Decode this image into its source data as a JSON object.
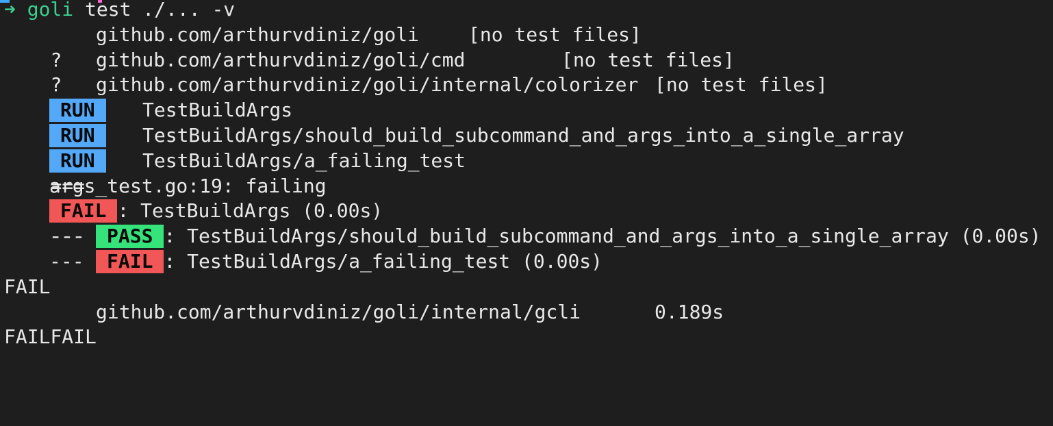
{
  "theme": {
    "background": "#1e1e1e",
    "foreground": "#e8e8e8",
    "prompt_color": "#3ccf91",
    "run_color": "#53a8f8",
    "fail_color": "#f25757",
    "pass_color": "#36e27a"
  },
  "prompt": {
    "arrow": "➜",
    "command_name": "goli",
    "args": " test ./... -v"
  },
  "no_test_lines": [
    {
      "marker": "?",
      "package": "github.com/arthurvdiniz/goli",
      "status": "[no test files]"
    },
    {
      "marker": "?",
      "package": "github.com/arthurvdiniz/goli/cmd",
      "status": "[no test files]"
    },
    {
      "marker": "?",
      "package": "github.com/arthurvdiniz/goli/internal/colorizer",
      "status": "[no test files]"
    }
  ],
  "run_lines": [
    {
      "prefix": "===",
      "badge": "RUN",
      "test": "TestBuildArgs"
    },
    {
      "prefix": "===",
      "badge": "RUN",
      "test": "TestBuildArgs/should_build_subcommand_and_args_into_a_single_array"
    },
    {
      "prefix": "===",
      "badge": "RUN",
      "test": "TestBuildArgs/a_failing_test"
    }
  ],
  "log_line": "args_test.go:19: failing",
  "result_lines": [
    {
      "prefix": "---",
      "badge": "FAIL",
      "text": ": TestBuildArgs (0.00s)",
      "indent": false
    },
    {
      "prefix": "---",
      "badge": "PASS",
      "text": ": TestBuildArgs/should_build_subcommand_and_args_into_a_single_array (0.00s)",
      "indent": true
    },
    {
      "prefix": "---",
      "badge": "FAIL",
      "text": ": TestBuildArgs/a_failing_test (0.00s)",
      "indent": true
    }
  ],
  "summary": {
    "fail1": "FAIL",
    "fail_pkg_status": "FAIL",
    "fail_pkg": "github.com/arthurvdiniz/goli/internal/gcli",
    "fail_pkg_time": "0.189s",
    "fail2": "FAIL"
  }
}
